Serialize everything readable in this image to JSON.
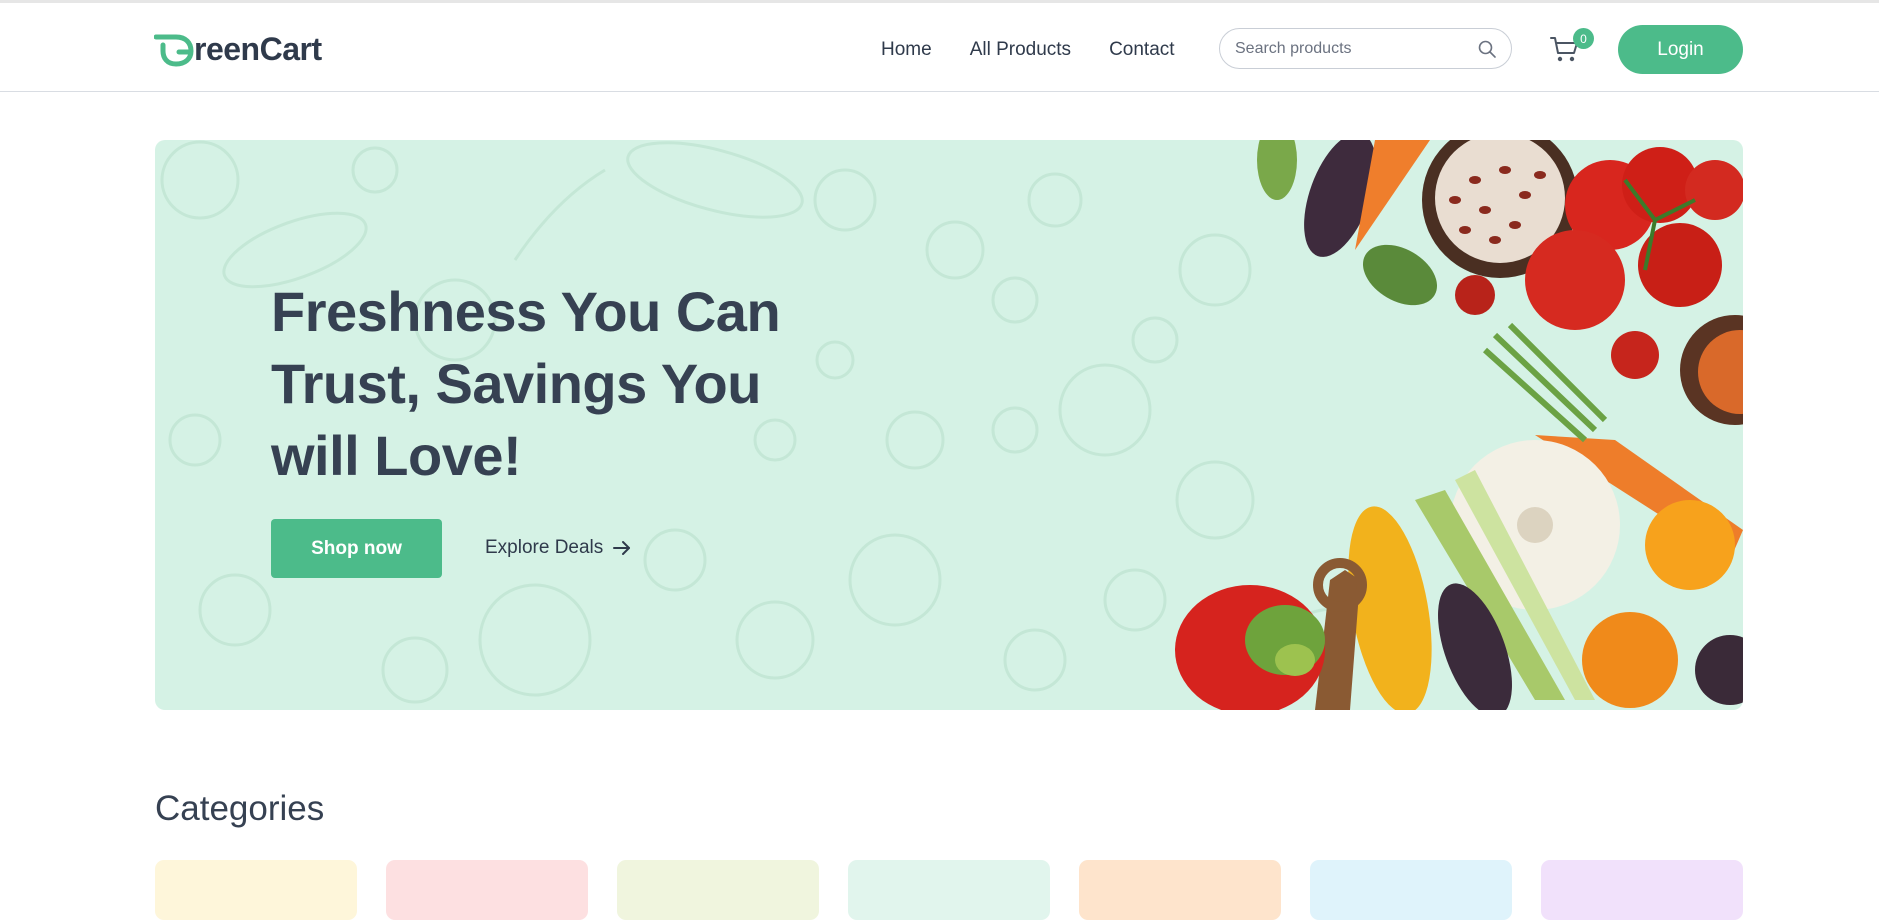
{
  "brand": {
    "name": "reenCart",
    "logo_letter": "G",
    "accent": "#4cbb8a"
  },
  "nav": {
    "links": [
      "Home",
      "All Products",
      "Contact"
    ],
    "search_placeholder": "Search products",
    "cart_count": "0",
    "login_label": "Login"
  },
  "hero": {
    "title_lines": [
      "Freshness You Can",
      "Trust, Savings You",
      "will Love!"
    ],
    "shop_label": "Shop now",
    "explore_label": "Explore Deals",
    "background": "#d5f2e5"
  },
  "categories": {
    "title": "Categories",
    "card_colors": [
      "#fef6da",
      "#fde0e1",
      "#f0f5de",
      "#e1f5ed",
      "#fee4cc",
      "#dff3fb",
      "#f1e1fb"
    ]
  },
  "icons": {
    "search": "search-icon",
    "cart": "cart-icon",
    "arrow": "arrow-right-icon"
  }
}
